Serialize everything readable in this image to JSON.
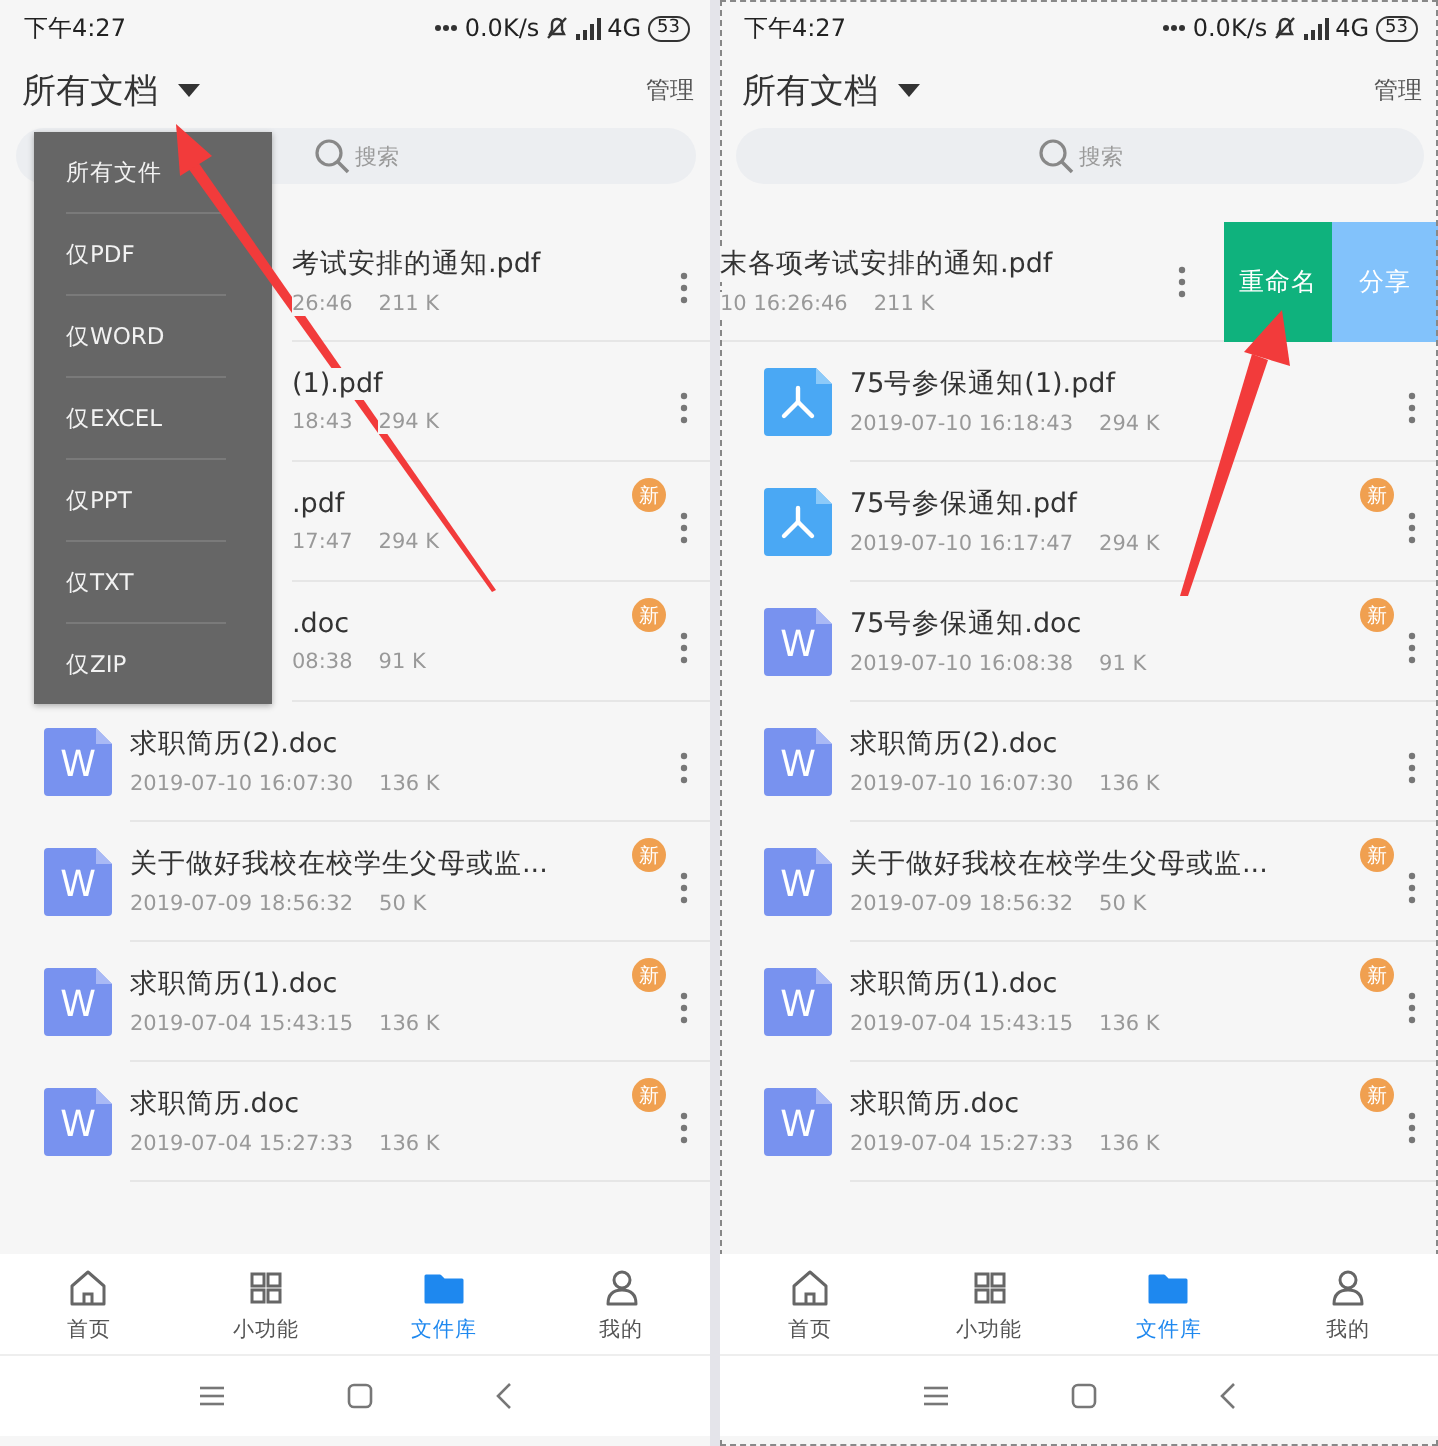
{
  "screens": [
    {
      "status_bar": {
        "time": "下午4:27",
        "speed": "0.0K/s",
        "network": "4G",
        "battery": "53"
      },
      "header": {
        "title": "所有文档",
        "action": "管理"
      },
      "search": {
        "placeholder": "搜索"
      },
      "dropdown": {
        "items": [
          "所有文件",
          "仅PDF",
          "仅WORD",
          "仅EXCEL",
          "仅PPT",
          "仅TXT",
          "仅ZIP"
        ]
      },
      "files": [
        {
          "title": "考试安排的通知.pdf",
          "date": "26:46",
          "size": "211 K"
        },
        {
          "title": "(1).pdf",
          "date": "18:43",
          "size": "294 K"
        },
        {
          "title": ".pdf",
          "date": "17:47",
          "size": "294 K",
          "badge": "新"
        },
        {
          "title": ".doc",
          "date": "08:38",
          "size": "91 K",
          "badge": "新"
        },
        {
          "kind": "word",
          "icon_label": "W",
          "title": "求职简历(2).doc",
          "date": "2019-07-10 16:07:30",
          "size": "136 K"
        },
        {
          "kind": "word",
          "icon_label": "W",
          "title": "关于做好我校在校学生父母或监...",
          "date": "2019-07-09 18:56:32",
          "size": "50 K",
          "badge": "新"
        },
        {
          "kind": "word",
          "icon_label": "W",
          "title": "求职简历(1).doc",
          "date": "2019-07-04 15:43:15",
          "size": "136 K",
          "badge": "新"
        },
        {
          "kind": "word",
          "icon_label": "W",
          "title": "求职简历.doc",
          "date": "2019-07-04 15:27:33",
          "size": "136 K",
          "badge": "新"
        }
      ],
      "tabs": [
        {
          "label": "首页",
          "selected": false
        },
        {
          "label": "小功能",
          "selected": false
        },
        {
          "label": "文件库",
          "selected": true
        },
        {
          "label": "我的",
          "selected": false
        }
      ]
    },
    {
      "status_bar": {
        "time": "下午4:27",
        "speed": "0.0K/s",
        "network": "4G",
        "battery": "53"
      },
      "header": {
        "title": "所有文档",
        "action": "管理"
      },
      "search": {
        "placeholder": "搜索"
      },
      "files": [
        {
          "title": "末各项考试安排的通知.pdf",
          "date": "10 16:26:46",
          "size": "211 K",
          "actions": [
            {
              "label": "重命名",
              "color": "#0fb27d"
            },
            {
              "label": "分享",
              "color": "#82c2fb"
            }
          ]
        },
        {
          "kind": "pdf",
          "title": "75号参保通知(1).pdf",
          "date": "2019-07-10 16:18:43",
          "size": "294 K"
        },
        {
          "kind": "pdf",
          "title": "75号参保通知.pdf",
          "date": "2019-07-10 16:17:47",
          "size": "294 K",
          "badge": "新"
        },
        {
          "kind": "word",
          "icon_label": "W",
          "title": "75号参保通知.doc",
          "date": "2019-07-10 16:08:38",
          "size": "91 K",
          "badge": "新"
        },
        {
          "kind": "word",
          "icon_label": "W",
          "title": "求职简历(2).doc",
          "date": "2019-07-10 16:07:30",
          "size": "136 K"
        },
        {
          "kind": "word",
          "icon_label": "W",
          "title": "关于做好我校在校学生父母或监...",
          "date": "2019-07-09 18:56:32",
          "size": "50 K",
          "badge": "新"
        },
        {
          "kind": "word",
          "icon_label": "W",
          "title": "求职简历(1).doc",
          "date": "2019-07-04 15:43:15",
          "size": "136 K",
          "badge": "新"
        },
        {
          "kind": "word",
          "icon_label": "W",
          "title": "求职简历.doc",
          "date": "2019-07-04 15:27:33",
          "size": "136 K",
          "badge": "新"
        }
      ],
      "tabs": [
        {
          "label": "首页",
          "selected": false
        },
        {
          "label": "小功能",
          "selected": false
        },
        {
          "label": "文件库",
          "selected": true
        },
        {
          "label": "我的",
          "selected": false
        }
      ]
    }
  ]
}
